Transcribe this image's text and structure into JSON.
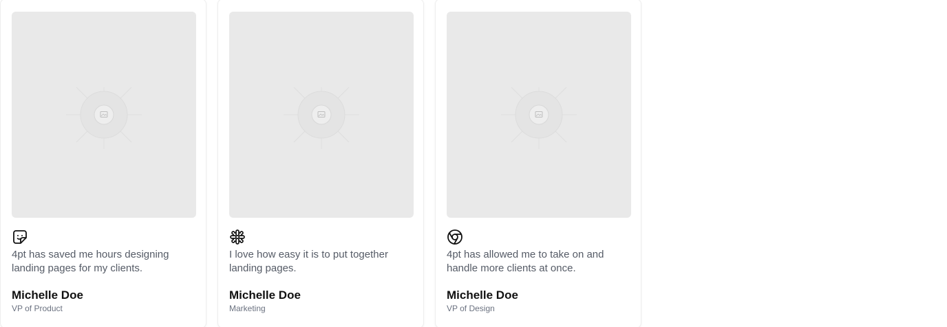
{
  "testimonials": [
    {
      "quote": "4pt has saved me hours designing landing pages for my clients.",
      "name": "Michelle Doe",
      "role": "VP of Product",
      "logo_icon": "smiley-sticker-icon"
    },
    {
      "quote": "I love how easy it is to put together landing pages.",
      "name": "Michelle Doe",
      "role": "Marketing",
      "logo_icon": "slack-logo-icon"
    },
    {
      "quote": "4pt has allowed me to take on and handle more clients at once.",
      "name": "Michelle Doe",
      "role": "VP of Design",
      "logo_icon": "chrome-logo-icon"
    }
  ],
  "colors": {
    "placeholder_bg": "#e9e9e9",
    "quote_text": "#555b66",
    "role_text": "#6b7280",
    "name_text": "#111111"
  }
}
